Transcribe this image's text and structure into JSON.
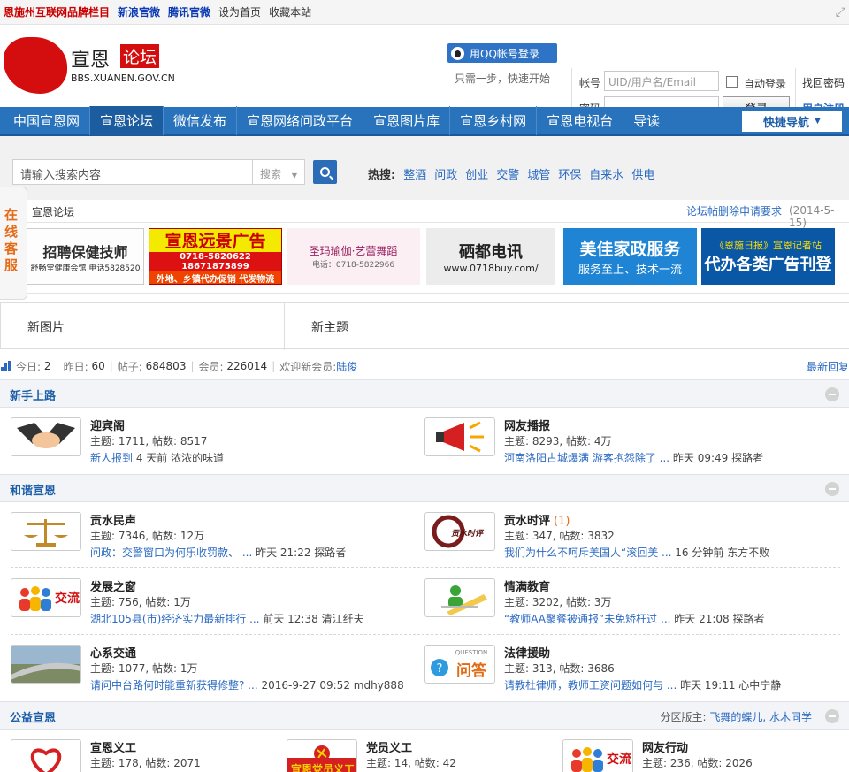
{
  "topbar": {
    "brand": "恩施州互联网品牌栏目",
    "sina": "新浪官微",
    "tencent": "腾讯官微",
    "set_home": "设为首页",
    "favorite": "收藏本站"
  },
  "logo": {
    "name": "宣恩",
    "tag": "论坛",
    "url": "BBS.XUANEN.GOV.CN"
  },
  "login": {
    "qq_button": "用QQ帐号登录",
    "qq_hint": "只需一步，快速开始",
    "account_label": "帐号",
    "account_placeholder": "UID/用户名/Email",
    "password_label": "密码",
    "auto_login": "自动登录",
    "login_button": "登录",
    "find_password": "找回密码",
    "register": "用户注册"
  },
  "nav": {
    "items": [
      "中国宣恩网",
      "宣恩论坛",
      "微信发布",
      "宣恩网络问政平台",
      "宣恩图片库",
      "宣恩乡村网",
      "宣恩电视台",
      "导读"
    ],
    "quick": "快捷导航"
  },
  "search": {
    "placeholder": "请输入搜索内容",
    "type": "搜索",
    "hot_label": "热搜:",
    "hot": [
      "整酒",
      "问政",
      "创业",
      "交警",
      "城管",
      "环保",
      "自来水",
      "供电"
    ]
  },
  "sidetab": "在线客服",
  "crumb": {
    "home": "宣恩论坛",
    "request": "论坛帖删除申请要求",
    "date": "(2014-5-15)"
  },
  "ads": [
    {
      "text": "招聘保健技师",
      "sub": "舒畅堂健康会馆 电话5828520"
    },
    {
      "text": "宣恩远景广告",
      "sub": "0718-5820622 18671875899",
      "sub2": "外地、乡镇代办促销  代发物流"
    },
    {
      "text": "圣玛瑜伽·艺蕾舞蹈",
      "sub": "电话：0718-5822966"
    },
    {
      "text": "硒都电讯",
      "sub": "www.0718buy.com/"
    },
    {
      "text": "美佳家政服务",
      "sub": "服务至上、技术一流"
    },
    {
      "text": "代办各类广告刊登",
      "sub": "《恩施日报》宣恩记者站"
    }
  ],
  "panels": {
    "new_pics": "新图片",
    "new_topics": "新主题"
  },
  "stats": {
    "today_label": "今日:",
    "today": "2",
    "yesterday_label": "昨日:",
    "yesterday": "60",
    "posts_label": "帖子:",
    "posts": "684803",
    "members_label": "会员:",
    "members": "226014",
    "welcome_label": "欢迎新会员:",
    "new_member": "陆俊",
    "latest": "最新回复"
  },
  "categories": [
    {
      "title": "新手上路",
      "forums": [
        {
          "name": "迎宾阁",
          "count": "",
          "stats": "主题: 1711, 帖数: 8517",
          "last_link": "新人报到",
          "last_time": " 4 天前",
          "last_user": " 浓浓的味道"
        },
        {
          "name": "网友播报",
          "count": "",
          "stats": "主题: 8293, 帖数: 4万",
          "last_link": "河南洛阳古城爆满 游客抱怨除了 ...",
          "last_time": " 昨天 09:49",
          "last_user": " 探路者"
        }
      ]
    },
    {
      "title": "和谐宣恩",
      "forums": [
        {
          "name": "贡水民声",
          "count": "",
          "stats": "主题: 7346, 帖数: 12万",
          "last_link": "问政：交警窗口为何乐收罚款、 ...",
          "last_time": " 昨天 21:22",
          "last_user": " 探路者"
        },
        {
          "name": "贡水时评",
          "count": "(1)",
          "stats": "主题: 347, 帖数: 3832",
          "last_link": "我们为什么不呵斥美国人“滚回美 ...",
          "last_time": " 16 分钟前",
          "last_user": " 东方不败"
        },
        {
          "name": "发展之窗",
          "count": "",
          "stats": "主题: 756, 帖数: 1万",
          "last_link": "湖北105县(市)经济实力最新排行 ...",
          "last_time": " 前天 12:38",
          "last_user": " 清江纤夫"
        },
        {
          "name": "情满教育",
          "count": "",
          "stats": "主题: 3202, 帖数: 3万",
          "last_link": "“教师AA聚餐被通报”未免矫枉过 ...",
          "last_time": " 昨天 21:08",
          "last_user": " 探路者"
        },
        {
          "name": "心系交通",
          "count": "",
          "stats": "主题: 1077, 帖数: 1万",
          "last_link": "请问中台路何时能重新获得修整? ...",
          "last_time": " 2016-9-27 09:52",
          "last_user": " mdhy888"
        },
        {
          "name": "法律援助",
          "count": "",
          "stats": "主题: 313, 帖数: 3686",
          "last_link": "请教杜律师，教师工资问题如何与 ...",
          "last_time": " 昨天 19:11",
          "last_user": " 心中宁静"
        }
      ]
    },
    {
      "title": "公益宣恩",
      "mods_label": "分区版主: ",
      "mods": "飞舞的蝶儿, 水木同学",
      "forums": [
        {
          "name": "宣恩义工",
          "count": "",
          "stats": "主题: 178, 帖数: 2071"
        },
        {
          "name": "党员义工",
          "count": "",
          "stats": "主题: 14, 帖数: 42"
        },
        {
          "name": "网友行动",
          "count": "",
          "stats": "主题: 236, 帖数: 2026"
        }
      ]
    }
  ],
  "icon_texts": {
    "jiaoliu": "交流",
    "wenda": "问答",
    "question": "QUESTION",
    "shiping": "贡水时评",
    "banner": "宣恩党员义工"
  }
}
